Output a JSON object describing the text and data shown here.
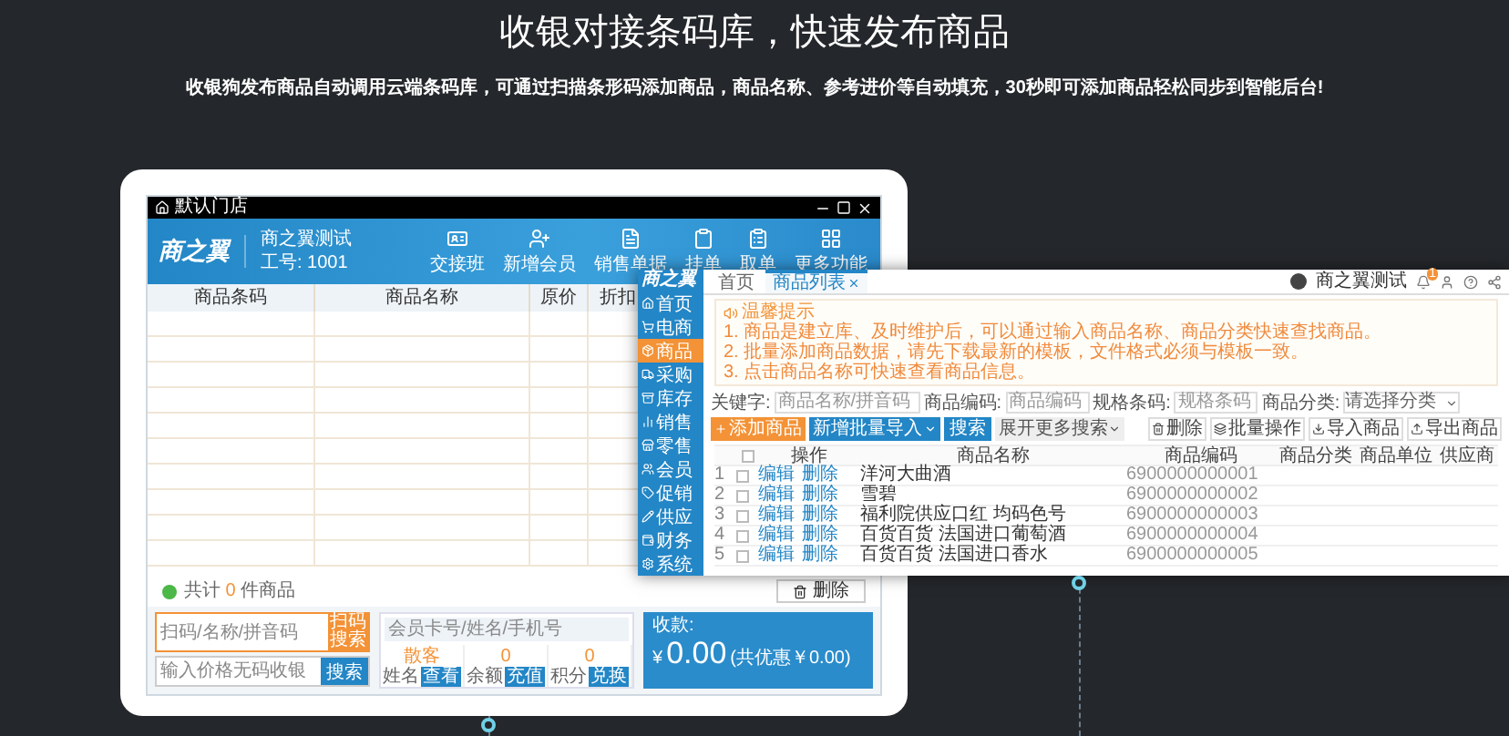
{
  "heading": {
    "title": "收银对接条码库，快速发布商品",
    "subtitle": "收银狗发布商品自动调用云端条码库，可通过扫描条形码添加商品，商品名称、参考进价等自动填充，30秒即可添加商品轻松同步到智能后台!"
  },
  "pos_window": {
    "title": "默认门店",
    "logo": "商之翼",
    "store_name": "商之翼测试",
    "staff_id": "工号: 1001",
    "toolbar": [
      "交接班",
      "新增会员",
      "销售单据",
      "挂单",
      "取单",
      "更多功能"
    ],
    "columns": [
      "商品条码",
      "商品名称",
      "原价",
      "折扣"
    ],
    "count_label": "共计",
    "count": "0",
    "count_unit": "件商品",
    "delete_button": "删除",
    "search_placeholder": "扫码/名称/拼音码",
    "scan_button": "扫码搜索",
    "price_placeholder": "输入价格无码收银",
    "search_button": "搜索",
    "member_placeholder": "会员卡号/姓名/手机号",
    "member_stats": [
      {
        "value": "散客",
        "label": "姓名",
        "action": "查看"
      },
      {
        "value": "0",
        "label": "余额",
        "action": "充值"
      },
      {
        "value": "0",
        "label": "积分",
        "action": "兑换"
      }
    ],
    "pay_label": "收款:",
    "currency": "¥",
    "amount": "0.00",
    "discount": "(共优惠￥0.00)"
  },
  "admin_window": {
    "logo": "商之翼",
    "nav": [
      {
        "label": "首页",
        "selected": false
      },
      {
        "label": "电商",
        "selected": false
      },
      {
        "label": "商品",
        "selected": true
      },
      {
        "label": "采购",
        "selected": false
      },
      {
        "label": "库存",
        "selected": false
      },
      {
        "label": "销售",
        "selected": false
      },
      {
        "label": "零售",
        "selected": false
      },
      {
        "label": "会员",
        "selected": false
      },
      {
        "label": "促销",
        "selected": false
      },
      {
        "label": "供应",
        "selected": false
      },
      {
        "label": "财务",
        "selected": false
      },
      {
        "label": "系统",
        "selected": false
      }
    ],
    "tabs": [
      {
        "label": "首页",
        "selected": false,
        "closable": false
      },
      {
        "label": "商品列表",
        "selected": true,
        "closable": true
      }
    ],
    "user": "商之翼测试",
    "notification_count": "1",
    "notice_title": "温馨提示",
    "notices": [
      "1. 商品是建立库、及时维护后，可以通过输入商品名称、商品分类快速查找商品。",
      "2. 批量添加商品数据，请先下载最新的模板，文件格式必须与模板一致。",
      "3. 点击商品名称可快速查看商品信息。"
    ],
    "filters": [
      {
        "label": "关键字:",
        "placeholder": "商品名称/拼音码",
        "kind": "input"
      },
      {
        "label": "商品编码:",
        "placeholder": "商品编码",
        "kind": "input"
      },
      {
        "label": "规格条码:",
        "placeholder": "规格条码",
        "kind": "input"
      },
      {
        "label": "商品分类:",
        "placeholder": "请选择分类",
        "kind": "select"
      }
    ],
    "search_button": "搜索",
    "more_search": "展开更多搜索",
    "primary_buttons": [
      {
        "label": "添加商品",
        "kind": "add"
      },
      {
        "label": "新增批量导入",
        "kind": "menu"
      }
    ],
    "action_buttons": [
      "删除",
      "批量操作",
      "导入商品",
      "导出商品"
    ],
    "all_checked": false,
    "columns": [
      "操作",
      "商品名称",
      "商品编码",
      "商品分类",
      "商品单位",
      "供应商"
    ],
    "rows": [
      {
        "number": "1",
        "checked": false,
        "actions": [
          "编辑",
          "删除"
        ],
        "name": "洋河大曲酒",
        "code": "6900000000001"
      },
      {
        "number": "2",
        "checked": false,
        "actions": [
          "编辑",
          "删除"
        ],
        "name": "雪碧",
        "code": "6900000000002"
      },
      {
        "number": "3",
        "checked": false,
        "actions": [
          "编辑",
          "删除"
        ],
        "name": "福利院供应口红 均码色号",
        "code": "6900000000003"
      },
      {
        "number": "4",
        "checked": false,
        "actions": [
          "编辑",
          "删除"
        ],
        "name": "百货百货 法国进口葡萄酒",
        "code": "6900000000004"
      },
      {
        "number": "5",
        "checked": false,
        "actions": [
          "编辑",
          "删除"
        ],
        "name": "百货百货 法国进口香水",
        "code": "6900000000005"
      }
    ]
  }
}
